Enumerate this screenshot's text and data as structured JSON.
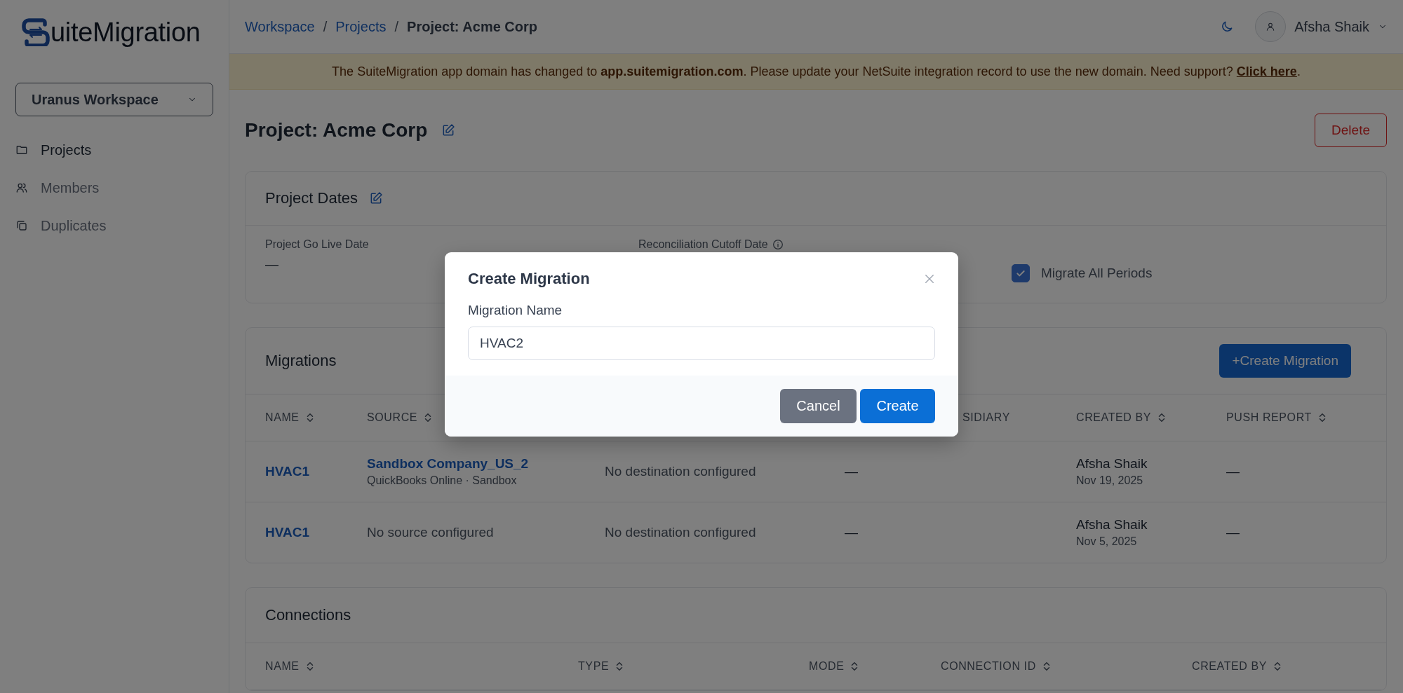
{
  "sidebar": {
    "logo_text": "uiteMigration",
    "workspace": "Uranus Workspace",
    "items": [
      {
        "label": "Projects",
        "selected": true
      },
      {
        "label": "Members",
        "selected": false
      },
      {
        "label": "Duplicates",
        "selected": false
      }
    ]
  },
  "topbar": {
    "breadcrumbs": [
      {
        "label": "Workspace",
        "kind": "link"
      },
      {
        "label": "Projects",
        "kind": "link"
      },
      {
        "label": "Project: Acme Corp",
        "kind": "current"
      }
    ],
    "separator": "/",
    "user": "Afsha Shaik"
  },
  "banner": {
    "text": "The SuiteMigration app domain has changed to **app.suitemigration.com**. Please update your NetSuite integration record to use the new domain. Need support? ",
    "link": "Click here",
    "after": "."
  },
  "page": {
    "title": "Project: Acme Corp",
    "delete_button": "Delete"
  },
  "dates": {
    "title": "Project Dates",
    "fields": [
      {
        "label": "Project Go Live Date",
        "value": "—",
        "info": false
      },
      {
        "label": "Reconciliation Cutoff Date",
        "info": true
      }
    ],
    "migrate_all": {
      "label": "Migrate All Periods",
      "checked": true
    }
  },
  "migrations": {
    "title": "Migrations",
    "create_button": "+Create Migration",
    "columns": [
      {
        "label": "NAME",
        "sortable": true
      },
      {
        "label": "SOURCE",
        "sortable": true
      },
      {
        "label": "SIDIARY",
        "sortable": false,
        "cut": true
      },
      {
        "label": "CREATED BY",
        "sortable": true
      },
      {
        "label": "PUSH REPORT",
        "sortable": true
      }
    ],
    "rows": [
      {
        "name": "HVAC1",
        "source": {
          "kind": "link",
          "name": "Sandbox Company_US_2",
          "detail": "QuickBooks Online · Sandbox"
        },
        "destination": "No destination configured",
        "subsidiary": "—",
        "created_by": "Afsha Shaik",
        "created_on": "Nov 19, 2025",
        "push_report": "—"
      },
      {
        "name": "HVAC1",
        "source": {
          "kind": "plain",
          "name": "No source configured"
        },
        "destination": "No destination configured",
        "subsidiary": "—",
        "created_by": "Afsha Shaik",
        "created_on": "Nov 5, 2025",
        "push_report": "—"
      }
    ]
  },
  "connections": {
    "title": "Connections",
    "columns": [
      {
        "label": "NAME",
        "sortable": true
      },
      {
        "label": "TYPE",
        "sortable": true
      },
      {
        "label": "MODE",
        "sortable": true
      },
      {
        "label": "CONNECTION ID",
        "sortable": true
      },
      {
        "label": "CREATED BY",
        "sortable": true
      }
    ]
  },
  "modal": {
    "title": "Create Migration",
    "field_label": "Migration Name",
    "value": "HVAC2",
    "buttons": [
      {
        "label": "Cancel",
        "kind": "secondary"
      },
      {
        "label": "Create",
        "kind": "primary"
      }
    ]
  }
}
